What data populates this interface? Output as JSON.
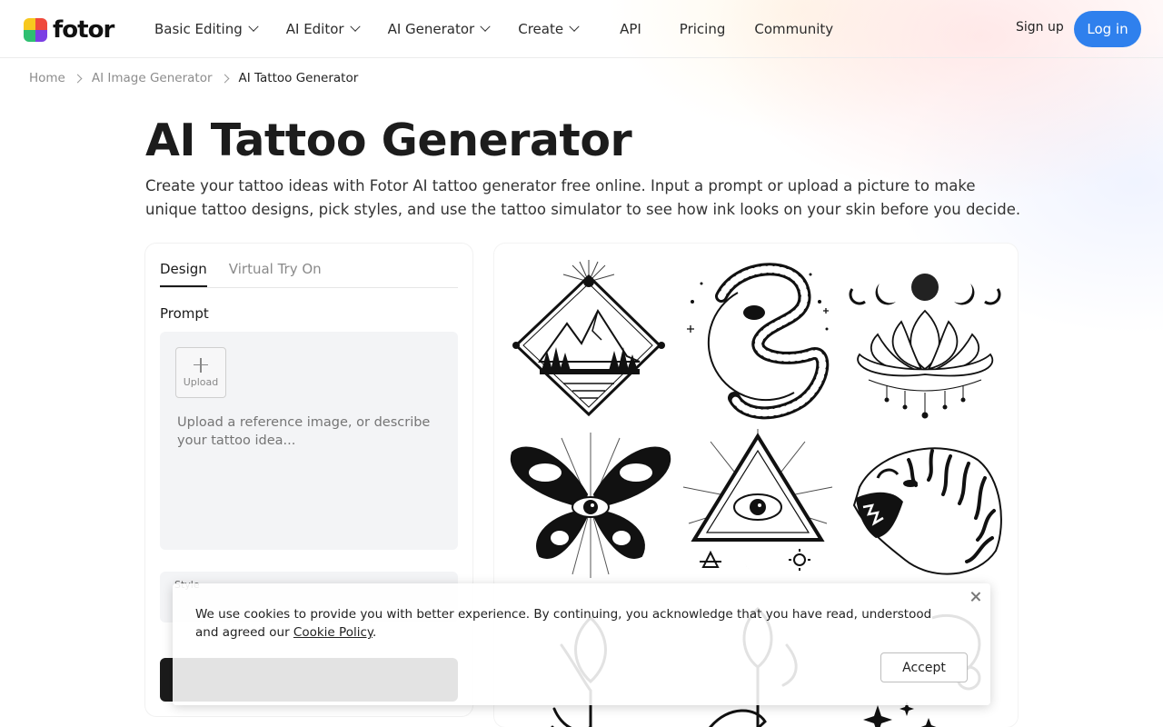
{
  "brand": {
    "name": "fotor",
    "colors": {
      "primary": "#2f80ed",
      "dark": "#1b1b1b"
    }
  },
  "nav": {
    "items": [
      {
        "label": "Basic Editing",
        "dropdown": true
      },
      {
        "label": "AI Editor",
        "dropdown": true
      },
      {
        "label": "AI Generator",
        "dropdown": true
      },
      {
        "label": "Create",
        "dropdown": true
      },
      {
        "label": "API",
        "dropdown": false
      },
      {
        "label": "Pricing",
        "dropdown": false
      },
      {
        "label": "Community",
        "dropdown": false
      }
    ],
    "signup": "Sign up",
    "login": "Log in"
  },
  "breadcrumb": [
    "Home",
    "AI Image Generator",
    "AI Tattoo Generator"
  ],
  "page": {
    "title": "AI Tattoo Generator",
    "description": "Create your tattoo ideas with Fotor AI tattoo generator free online. Input a prompt or upload a picture to make unique tattoo designs, pick styles, and use the tattoo simulator to see how ink looks on your skin before you decide."
  },
  "panel": {
    "tabs": [
      "Design",
      "Virtual Try On"
    ],
    "active_tab": "Design",
    "prompt_label": "Prompt",
    "upload_label": "Upload",
    "prompt_placeholder": "Upload a reference image, or describe your tattoo idea...",
    "style_label": "Style"
  },
  "gallery": {
    "items": [
      "mountain-diamond-tattoo",
      "snake-moon-tattoo",
      "lotus-moon-tattoo",
      "butterfly-eye-tattoo",
      "all-seeing-eye-tattoo",
      "roaring-tiger-tattoo",
      "floral-tattoo",
      "leaf-branch-tattoo",
      "celestial-tattoo"
    ]
  },
  "cookie": {
    "text": "We use cookies to provide you with better experience. By continuing, you acknowledge that you have read, understood and agreed our ",
    "link": "Cookie Policy",
    "suffix": ".",
    "accept": "Accept"
  }
}
